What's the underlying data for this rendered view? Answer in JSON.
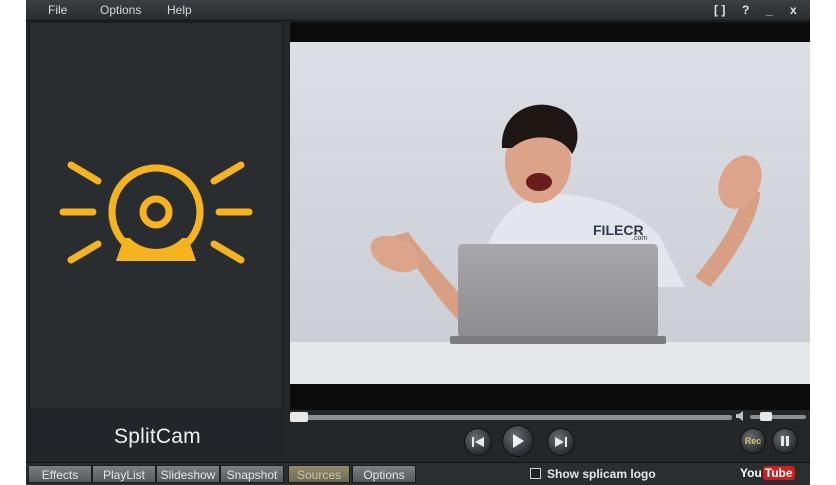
{
  "menu": {
    "file": "File",
    "options": "Options",
    "help": "Help"
  },
  "window_controls": {
    "fullscreen": "[ ]",
    "help": "?",
    "minimize": "_",
    "close": "x"
  },
  "brand": {
    "name": "SplitCam"
  },
  "video": {
    "watermark": "FILECR",
    "watermark_sub": ".com"
  },
  "player": {
    "rec_label": "Rec"
  },
  "tabs": [
    {
      "label": "Effects",
      "active": false
    },
    {
      "label": "PlayList",
      "active": false
    },
    {
      "label": "Slideshow",
      "active": false
    },
    {
      "label": "Snapshot",
      "active": false
    },
    {
      "label": "Sources",
      "active": true
    },
    {
      "label": "Options",
      "active": false
    }
  ],
  "footer": {
    "show_logo_label": "Show splicam logo",
    "show_logo_checked": false,
    "youtube_you": "You",
    "youtube_tube": "Tube"
  },
  "colors": {
    "accent": "#f5b320",
    "background": "#24272a"
  }
}
